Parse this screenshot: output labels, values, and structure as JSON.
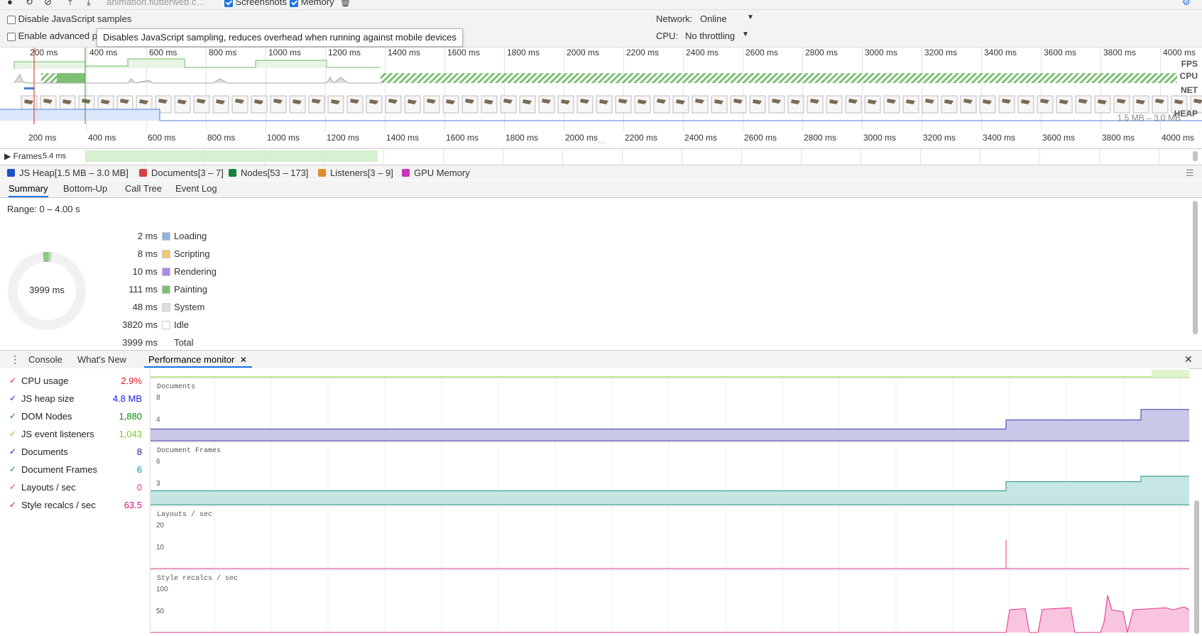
{
  "toolbar": {
    "url": "animation.flutterweb.c…",
    "screenshots_label": "Screenshots",
    "memory_label": "Memory"
  },
  "settings": {
    "disable_js_samples": "Disable JavaScript samples",
    "enable_advanced": "Enable advanced p",
    "network_label": "Network:",
    "network_value": "Online",
    "cpu_label": "CPU:",
    "cpu_value": "No throttling",
    "tooltip": "Disables JavaScript sampling, reduces overhead when running against mobile devices"
  },
  "overview": {
    "ticks": [
      "200 ms",
      "400 ms",
      "600 ms",
      "800 ms",
      "1000 ms",
      "1200 ms",
      "1400 ms",
      "1600 ms",
      "1800 ms",
      "2000 ms",
      "2200 ms",
      "2400 ms",
      "2600 ms",
      "2800 ms",
      "3000 ms",
      "3200 ms",
      "3400 ms",
      "3600 ms",
      "3800 ms",
      "4000 ms"
    ],
    "tracks": {
      "fps": "FPS",
      "cpu": "CPU",
      "net": "NET",
      "heap": "HEAP"
    },
    "heap_range": "1.5 MB – 3.0 MB"
  },
  "frames": {
    "label": "Frames",
    "value": "5.4 ms"
  },
  "counters": [
    {
      "label": "JS Heap[1.5 MB – 3.0 MB]",
      "color": "#1a4fc5"
    },
    {
      "label": "Documents[3 – 7]",
      "color": "#d14343"
    },
    {
      "label": "Nodes[53 – 173]",
      "color": "#188038"
    },
    {
      "label": "Listeners[3 – 9]",
      "color": "#e08c2e"
    },
    {
      "label": "GPU Memory",
      "color": "#c634b5"
    }
  ],
  "detail_tabs": [
    "Summary",
    "Bottom-Up",
    "Call Tree",
    "Event Log"
  ],
  "summary": {
    "range": "Range: 0 – 4.00 s",
    "total_center": "3999 ms",
    "rows": [
      {
        "ms": "2 ms",
        "label": "Loading",
        "color": "#8fb4e4"
      },
      {
        "ms": "8 ms",
        "label": "Scripting",
        "color": "#f2c86a"
      },
      {
        "ms": "10 ms",
        "label": "Rendering",
        "color": "#a98bea"
      },
      {
        "ms": "111 ms",
        "label": "Painting",
        "color": "#7dbf74"
      },
      {
        "ms": "48 ms",
        "label": "System",
        "color": "#dedede"
      },
      {
        "ms": "3820 ms",
        "label": "Idle",
        "color": "#ffffff"
      },
      {
        "ms": "3999 ms",
        "label": "Total",
        "color": ""
      }
    ]
  },
  "drawer_tabs": [
    "Console",
    "What's New",
    "Performance monitor"
  ],
  "metrics": [
    {
      "label": "CPU usage",
      "value": "2.9%",
      "color": "#e0162b"
    },
    {
      "label": "JS heap size",
      "value": "4.8 MB",
      "color": "#1a1ae6"
    },
    {
      "label": "DOM Nodes",
      "value": "1,880",
      "color": "#0a8a0a"
    },
    {
      "label": "JS event listeners",
      "value": "1,043",
      "color": "#7cc82b"
    },
    {
      "label": "Documents",
      "value": "8",
      "color": "#1b1b9e"
    },
    {
      "label": "Document Frames",
      "value": "6",
      "color": "#0c9a8c"
    },
    {
      "label": "Layouts / sec",
      "value": "0",
      "color": "#e23a9c"
    },
    {
      "label": "Style recalcs / sec",
      "value": "63.5",
      "color": "#d4107f"
    }
  ],
  "graphs": [
    {
      "title": "Documents",
      "ticks": [
        "8",
        "4"
      ],
      "fill": "#c9c8e9",
      "stroke": "#3a3aa0"
    },
    {
      "title": "Document Frames",
      "ticks": [
        "6",
        "3"
      ],
      "fill": "#c6e6e3",
      "stroke": "#1c8f84"
    },
    {
      "title": "Layouts / sec",
      "ticks": [
        "20",
        "10"
      ],
      "fill": "#f8d0e6",
      "stroke": "#e0368f"
    },
    {
      "title": "Style recalcs / sec",
      "ticks": [
        "100",
        "50"
      ],
      "fill": "#f9c4e0",
      "stroke": "#e0368f"
    }
  ]
}
